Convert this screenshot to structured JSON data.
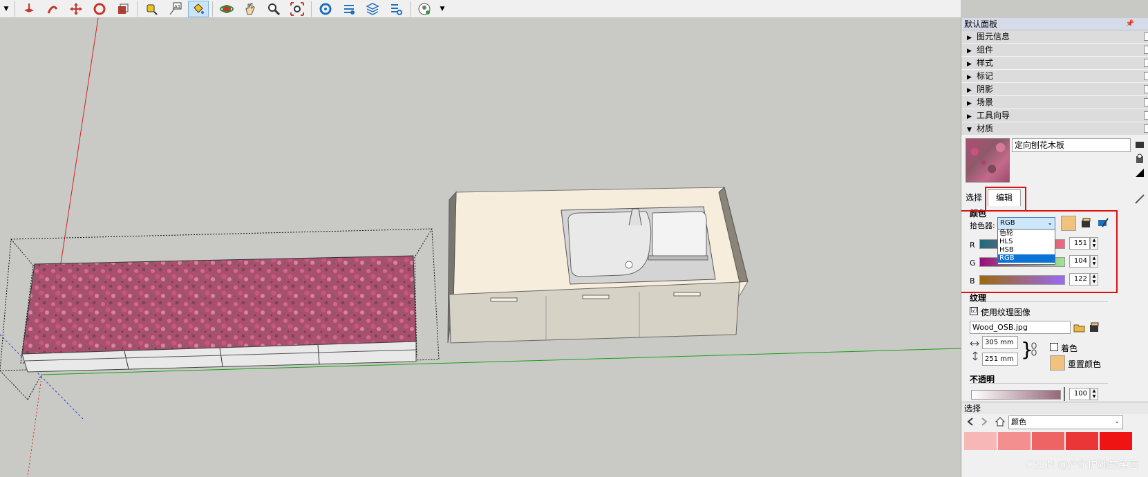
{
  "toolbar": {
    "tools": [
      {
        "icon": "push-pull-icon"
      },
      {
        "icon": "follow-me-icon"
      },
      {
        "icon": "move-icon"
      },
      {
        "icon": "rotate-icon"
      },
      {
        "icon": "scale-icon"
      },
      {
        "icon": "tape-measure-icon"
      },
      {
        "icon": "text-icon"
      },
      {
        "icon": "paint-bucket-icon"
      },
      {
        "icon": "orbit-icon"
      },
      {
        "icon": "pan-icon"
      },
      {
        "icon": "zoom-icon"
      },
      {
        "icon": "zoom-extents-icon"
      },
      {
        "icon": "extension-warehouse-icon"
      },
      {
        "icon": "components-3d-icon"
      },
      {
        "icon": "layers-icon"
      },
      {
        "icon": "settings-icon"
      },
      {
        "icon": "account-icon"
      }
    ]
  },
  "panel": {
    "title": "默认面板",
    "trays": [
      "图元信息",
      "组件",
      "样式",
      "标记",
      "阴影",
      "场景",
      "工具向导",
      "材质"
    ],
    "material": {
      "name": "定向刨花木板",
      "tabs": {
        "select": "选择",
        "edit": "编辑"
      },
      "color_section": "颜色",
      "picker_label": "拾色器:",
      "picker_value": "RGB",
      "picker_options": [
        "色轮",
        "HLS",
        "HSB",
        "RGB"
      ],
      "channels": [
        {
          "label": "R",
          "value": "151"
        },
        {
          "label": "G",
          "value": "104"
        },
        {
          "label": "B",
          "value": "122"
        }
      ],
      "swatch_color": "#f0c27e",
      "texture_section": "纹理",
      "use_texture_label": "使用纹理图像",
      "use_texture_checked": "☑",
      "texture_file": "Wood_OSB.jpg",
      "width": "305 mm",
      "height": "251 mm",
      "colorize_label": "着色",
      "reset_color_label": "重置颜色",
      "opacity_section": "不透明",
      "opacity_value": "100"
    },
    "select_panel": {
      "title": "选择",
      "library_value": "颜色"
    }
  },
  "watermark": "CSDN @/*守护她的笑容"
}
